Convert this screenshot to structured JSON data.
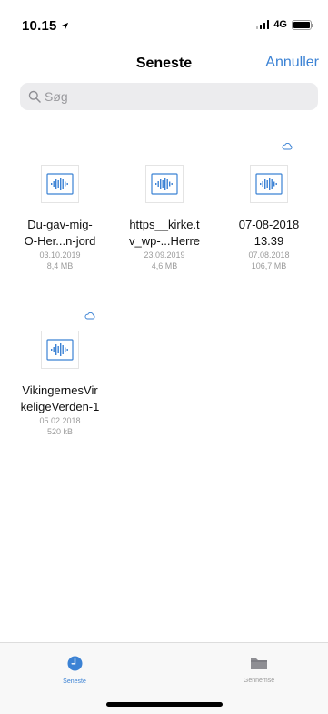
{
  "status_bar": {
    "time": "10.15",
    "network": "4G"
  },
  "nav": {
    "title": "Seneste",
    "cancel_label": "Annuller"
  },
  "search": {
    "placeholder": "Søg",
    "value": ""
  },
  "files": [
    {
      "name_line1": "Du-gav-mig-",
      "name_line2": "O-Her...n-jord",
      "date": "03.10.2019",
      "size": "8,4 MB",
      "cloud": false
    },
    {
      "name_line1": "https__kirke.t",
      "name_line2": "v_wp-...Herre",
      "date": "23.09.2019",
      "size": "4,6 MB",
      "cloud": false
    },
    {
      "name_line1": "07-08-2018",
      "name_line2": "13.39",
      "date": "07.08.2018",
      "size": "106,7 MB",
      "cloud": true
    },
    {
      "name_line1": "VikingernesVir",
      "name_line2": "keligeVerden-1",
      "date": "05.02.2018",
      "size": "520 kB",
      "cloud": true
    }
  ],
  "tabs": {
    "recent_label": "Seneste",
    "browse_label": "Gennemse"
  },
  "colors": {
    "accent": "#3b82d4",
    "icon_blue": "#3b82d4"
  }
}
